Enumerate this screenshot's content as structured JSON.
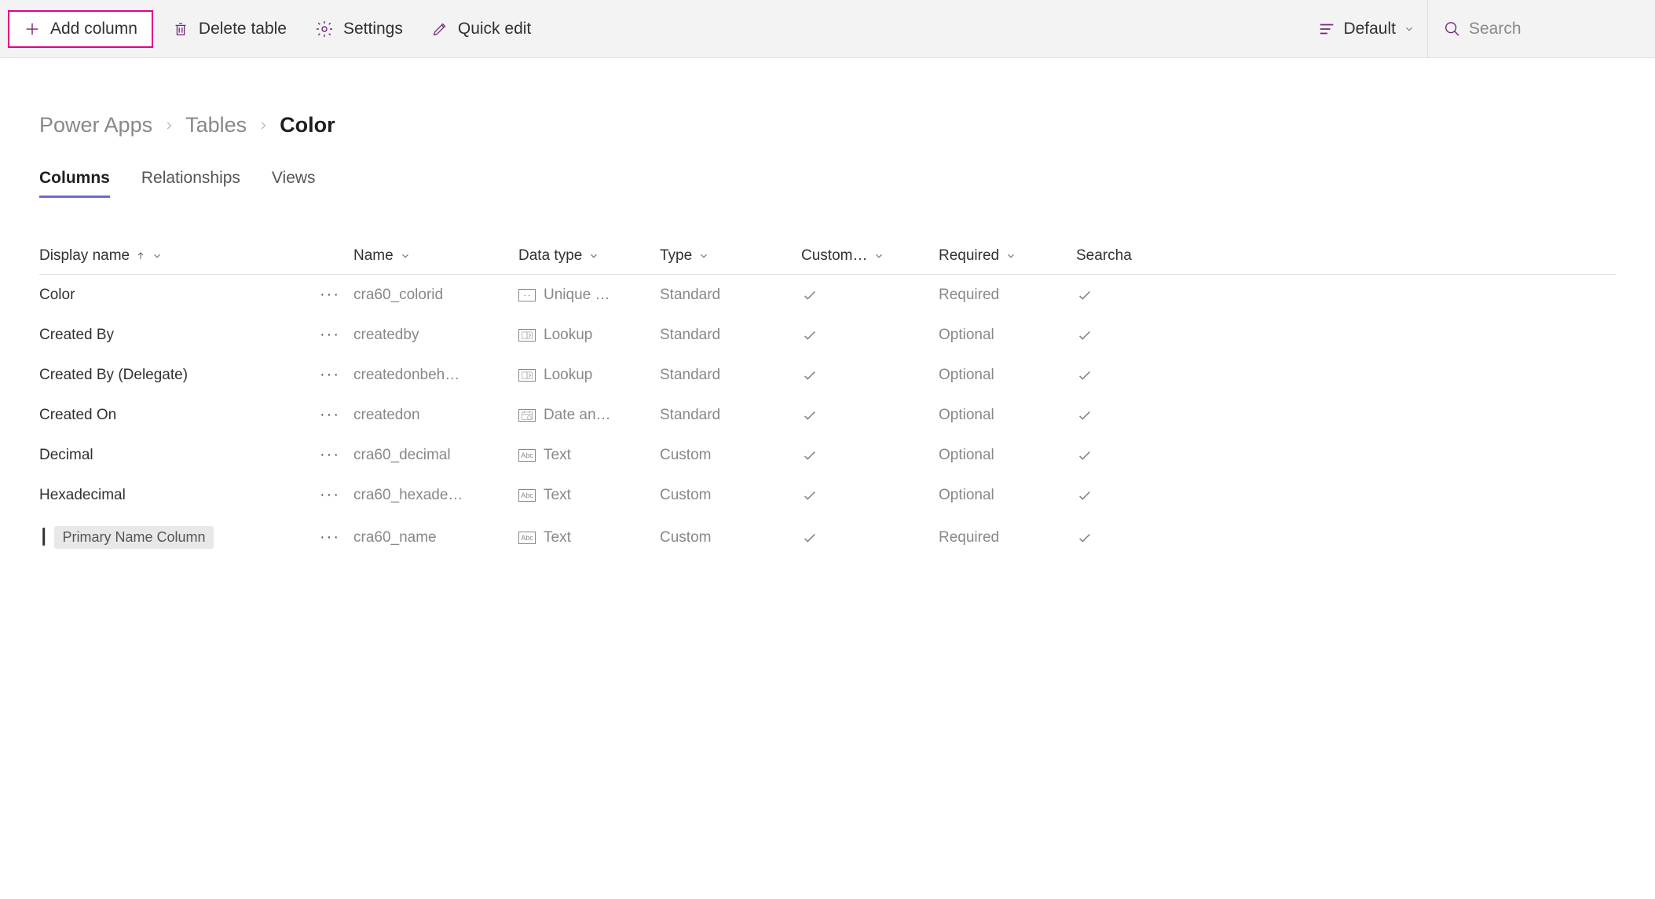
{
  "toolbar": {
    "add_column": "Add column",
    "delete_table": "Delete table",
    "settings": "Settings",
    "quick_edit": "Quick edit",
    "view_label": "Default",
    "search_placeholder": "Search"
  },
  "breadcrumb": {
    "root": "Power Apps",
    "level1": "Tables",
    "current": "Color"
  },
  "tabs": {
    "columns": "Columns",
    "relationships": "Relationships",
    "views": "Views"
  },
  "table": {
    "headers": {
      "display_name": "Display name",
      "name": "Name",
      "data_type": "Data type",
      "type": "Type",
      "custom": "Custom…",
      "required": "Required",
      "searchable": "Searcha"
    },
    "rows": [
      {
        "display": "Color",
        "name": "cra60_colorid",
        "data_type": "Unique …",
        "type": "Standard",
        "custom": true,
        "required": "Required",
        "searchable": true,
        "dt_icon": "unique"
      },
      {
        "display": "Created By",
        "name": "createdby",
        "data_type": "Lookup",
        "type": "Standard",
        "custom": true,
        "required": "Optional",
        "searchable": true,
        "dt_icon": "lookup"
      },
      {
        "display": "Created By (Delegate)",
        "name": "createdonbeh…",
        "data_type": "Lookup",
        "type": "Standard",
        "custom": true,
        "required": "Optional",
        "searchable": true,
        "dt_icon": "lookup"
      },
      {
        "display": "Created On",
        "name": "createdon",
        "data_type": "Date an…",
        "type": "Standard",
        "custom": true,
        "required": "Optional",
        "searchable": true,
        "dt_icon": "date"
      },
      {
        "display": "Decimal",
        "name": "cra60_decimal",
        "data_type": "Text",
        "type": "Custom",
        "custom": true,
        "required": "Optional",
        "searchable": true,
        "dt_icon": "text"
      },
      {
        "display": "Hexadecimal",
        "name": "cra60_hexade…",
        "data_type": "Text",
        "type": "Custom",
        "custom": true,
        "required": "Optional",
        "searchable": true,
        "dt_icon": "text"
      },
      {
        "display": "┃",
        "badge": "Primary Name Column",
        "name": "cra60_name",
        "data_type": "Text",
        "type": "Custom",
        "custom": true,
        "required": "Required",
        "searchable": true,
        "dt_icon": "text"
      }
    ]
  }
}
